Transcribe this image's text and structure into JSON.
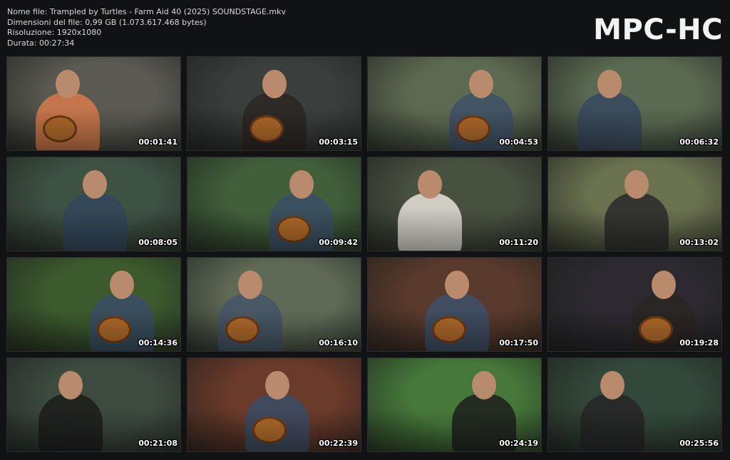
{
  "header": {
    "file_name": "Nome file: Trampled by Turtles - Farm Aid 40 (2025) SOUNDSTAGE.mkv",
    "file_size": "Dimensioni del file: 0,99 GB (1.073.617.468 bytes)",
    "resolution": "Risoluzione: 1920x1080",
    "duration": "Durata: 00:27:34"
  },
  "brand": "MPC-HC",
  "thumbnails": [
    {
      "timestamp": "00:01:41",
      "bg": "#5a5a52",
      "shirt": "#d87a4a",
      "guitar": true
    },
    {
      "timestamp": "00:03:15",
      "bg": "#3a3e3c",
      "shirt": "#2a2622",
      "guitar": true
    },
    {
      "timestamp": "00:04:53",
      "bg": "#5d6a52",
      "shirt": "#3e5068",
      "guitar": true
    },
    {
      "timestamp": "00:06:32",
      "bg": "#5a6a52",
      "shirt": "#36485e",
      "guitar": false
    },
    {
      "timestamp": "00:08:05",
      "bg": "#3e5244",
      "shirt": "#34475d",
      "guitar": false
    },
    {
      "timestamp": "00:09:42",
      "bg": "#41603a",
      "shirt": "#3b4f66",
      "guitar": true
    },
    {
      "timestamp": "00:11:20",
      "bg": "#48503f",
      "shirt": "#e6e2da",
      "guitar": false
    },
    {
      "timestamp": "00:13:02",
      "bg": "#6a7250",
      "shirt": "#2a2a2a",
      "guitar": false
    },
    {
      "timestamp": "00:14:36",
      "bg": "#3c5a2e",
      "shirt": "#3a4e66",
      "guitar": true
    },
    {
      "timestamp": "00:16:10",
      "bg": "#5f6a56",
      "shirt": "#44556a",
      "guitar": true
    },
    {
      "timestamp": "00:17:50",
      "bg": "#5a3a2c",
      "shirt": "#3c506a",
      "guitar": true
    },
    {
      "timestamp": "00:19:28",
      "bg": "#2c2a30",
      "shirt": "#2a2624",
      "guitar": true
    },
    {
      "timestamp": "00:21:08",
      "bg": "#3c4a40",
      "shirt": "#1c1c1c",
      "guitar": false
    },
    {
      "timestamp": "00:22:39",
      "bg": "#6a3a2a",
      "shirt": "#3a4d66",
      "guitar": true
    },
    {
      "timestamp": "00:24:19",
      "bg": "#46783a",
      "shirt": "#1e1e1e",
      "guitar": false
    },
    {
      "timestamp": "00:25:56",
      "bg": "#33473a",
      "shirt": "#262626",
      "guitar": false
    }
  ]
}
